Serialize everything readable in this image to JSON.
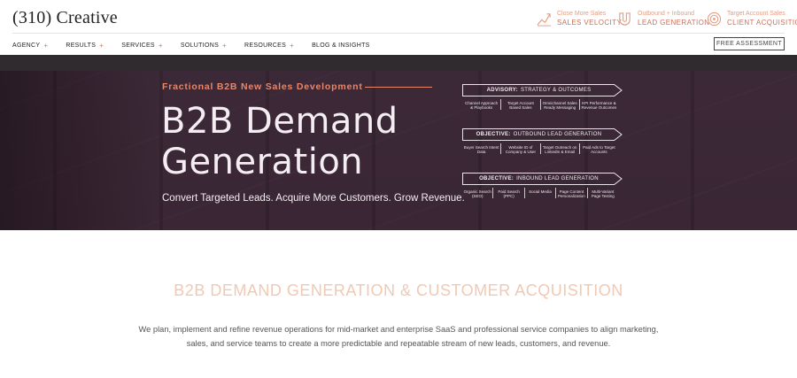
{
  "brand": {
    "logo_text": "(310) Creative"
  },
  "promos": [
    {
      "small": "Close More Sales",
      "big": "SALES VELOCITY",
      "icon": "speed-chart-icon"
    },
    {
      "small": "Outbound + Inbound",
      "big": "LEAD GENERATION",
      "icon": "magnet-icon"
    },
    {
      "small": "Target Account Sales",
      "big": "CLIENT ACQUISITION",
      "icon": "target-icon"
    }
  ],
  "nav": {
    "items": [
      {
        "label": "AGENCY",
        "has_plus": true
      },
      {
        "label": "RESULTS",
        "has_plus": true
      },
      {
        "label": "SERVICES",
        "has_plus": true
      },
      {
        "label": "SOLUTIONS",
        "has_plus": true
      },
      {
        "label": "RESOURCES",
        "has_plus": true
      },
      {
        "label": "BLOG & INSIGHTS",
        "has_plus": false
      }
    ],
    "plus_symbol": "+",
    "cta_label": "FREE ASSESSMENT"
  },
  "hero": {
    "eyebrow": "Fractional B2B New Sales Development",
    "title_line1": "B2B Demand",
    "title_line2": "Generation",
    "tagline": "Convert Targeted Leads. Acquire More Customers. Grow Revenue."
  },
  "diagram": {
    "blocks": [
      {
        "label_bold": "ADVISORY:",
        "label": "STRATEGY & OUTCOMES",
        "cells": [
          "Channel Approach & Playbooks",
          "Target Account Based Sales",
          "Omnichannel Sales Ready Messaging",
          "KPI Performance & Revenue Outcomes"
        ]
      },
      {
        "label_bold": "OBJECTIVE:",
        "label": "OUTBOUND LEAD GENERATION",
        "cells": [
          "Buyer Search Intent Data",
          "Website ID of Company & User",
          "Target Outreach on LinkedIn & Email",
          "Paid Ads to Target Accounts"
        ]
      },
      {
        "label_bold": "OBJECTIVE:",
        "label": "INBOUND LEAD GENERATION",
        "cells": [
          "Organic Search (SEO)",
          "Paid Search (PPC)",
          "Social Media",
          "Page Content Personalization",
          "Multi-Variant Page Testing"
        ]
      }
    ]
  },
  "content": {
    "heading": "B2B DEMAND GENERATION & CUSTOMER ACQUISITION",
    "body": "We plan, implement and refine revenue operations for mid-market and enterprise SaaS and professional service companies to align marketing, sales, and service teams to create a more predictable and repeatable stream of new leads, customers, and revenue."
  },
  "colors": {
    "accent": "#e2725b",
    "hero_bg": "#3a2634",
    "heading_peach": "#f0c9b3"
  }
}
